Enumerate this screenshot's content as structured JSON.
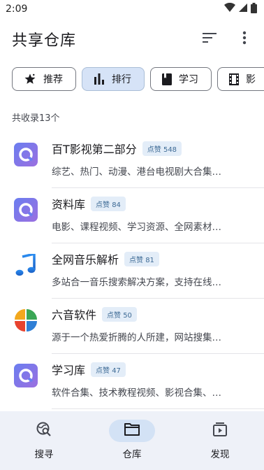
{
  "status_bar": {
    "time": "2:09"
  },
  "app_bar": {
    "title": "共享仓库"
  },
  "chips": [
    {
      "label": "推荐",
      "icon": "star-icon",
      "selected": false
    },
    {
      "label": "排行",
      "icon": "bar-chart-icon",
      "selected": true
    },
    {
      "label": "学习",
      "icon": "book-icon",
      "selected": false
    },
    {
      "label": "影",
      "icon": "film-icon",
      "selected": false
    }
  ],
  "collection_count": "共收录13个",
  "items": [
    {
      "title": "百T影视第二部分",
      "likes": "点赞 548",
      "desc": "综艺、热门、动漫、港台电视剧大合集…",
      "icon": "repo-logo-icon"
    },
    {
      "title": "资料库",
      "likes": "点赞 84",
      "desc": "电影、课程视频、学习资源、全网素材…",
      "icon": "repo-logo-icon"
    },
    {
      "title": "全网音乐解析",
      "likes": "点赞 81",
      "desc": "多站合一音乐搜索解决方案，支持在线…",
      "icon": "music-note-icon"
    },
    {
      "title": "六音软件",
      "likes": "点赞 50",
      "desc": "源于一个热爱折腾的人所建，网站搜集…",
      "icon": "four-petal-logo-icon"
    },
    {
      "title": "学习库",
      "likes": "点赞 47",
      "desc": "软件合集、技术教程视频、影视合集、…",
      "icon": "repo-logo-icon"
    }
  ],
  "bottom_nav": [
    {
      "label": "搜寻",
      "icon": "search-globe-icon",
      "active": false
    },
    {
      "label": "仓库",
      "icon": "folder-icon",
      "active": true
    },
    {
      "label": "发现",
      "icon": "video-library-icon",
      "active": false
    }
  ]
}
